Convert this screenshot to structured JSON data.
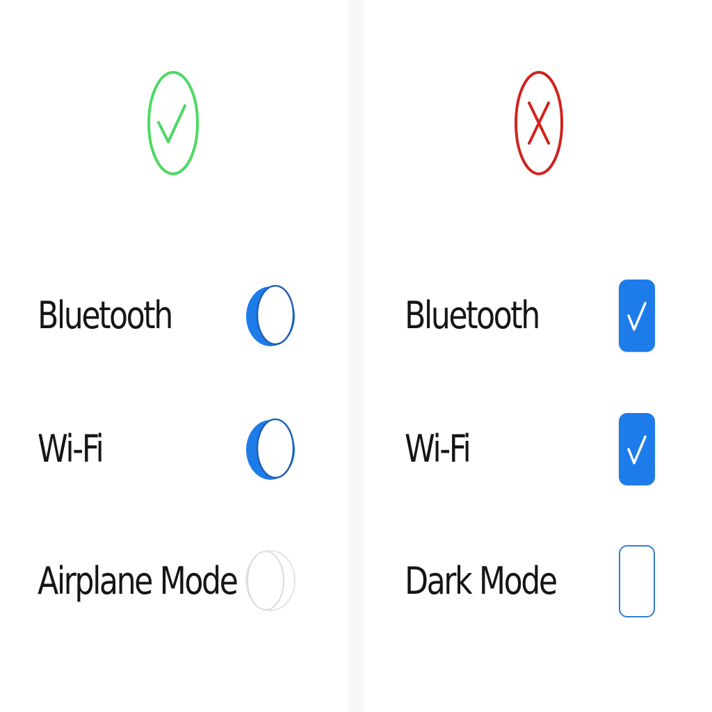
{
  "good_example": {
    "verdict_icon": "check-circle-icon",
    "verdict_color": "#4cd964",
    "control_type": "toggle",
    "on_color": "#1e7bea",
    "rows": [
      {
        "label": "Bluetooth",
        "on": true
      },
      {
        "label": "Wi-Fi",
        "on": true
      },
      {
        "label": "Airplane Mode",
        "on": false
      }
    ]
  },
  "bad_example": {
    "verdict_icon": "x-circle-icon",
    "verdict_color": "#d0231e",
    "control_type": "checkbox",
    "checked_color": "#1e7bea",
    "rows": [
      {
        "label": "Bluetooth",
        "checked": true
      },
      {
        "label": "Wi-Fi",
        "checked": true
      },
      {
        "label": "Dark Mode",
        "checked": false
      }
    ]
  }
}
